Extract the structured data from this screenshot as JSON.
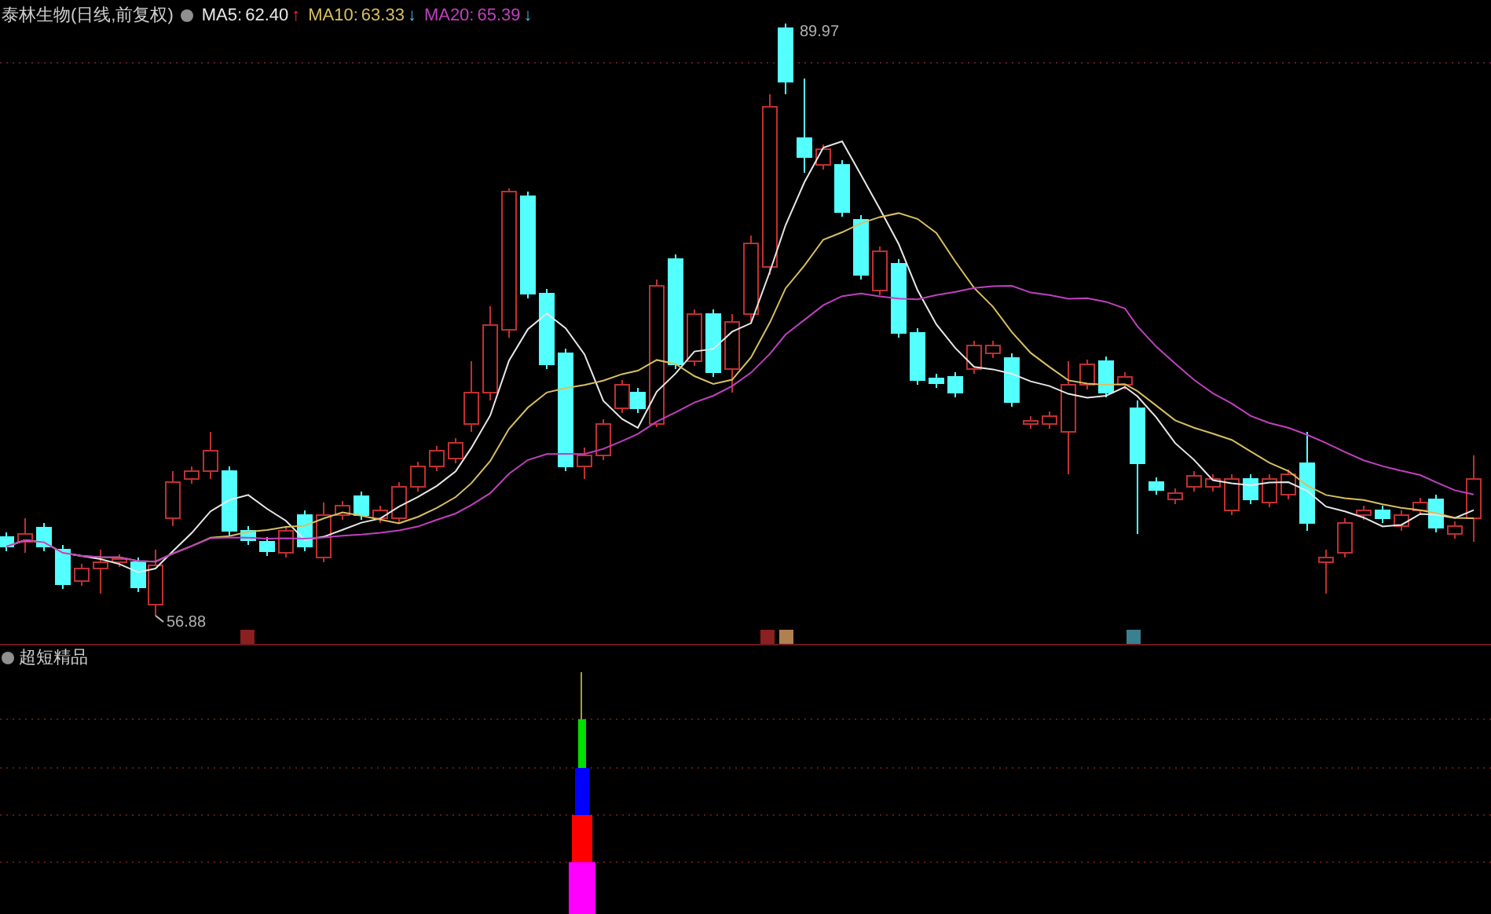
{
  "main_chart": {
    "title": "泰林生物(日线,前复权)",
    "indicators": [
      {
        "name": "MA5:",
        "value": "62.40",
        "arrow": "↑",
        "rising": true,
        "color": "#e8e8e8"
      },
      {
        "name": "MA10:",
        "value": "63.33",
        "arrow": "↓",
        "rising": false,
        "color": "#d8c060"
      },
      {
        "name": "MA20:",
        "value": "65.39",
        "arrow": "↓",
        "rising": false,
        "color": "#c040c0"
      }
    ],
    "high_label": "89.97",
    "low_label": "56.88"
  },
  "sub_chart": {
    "title": "超短精品"
  }
}
